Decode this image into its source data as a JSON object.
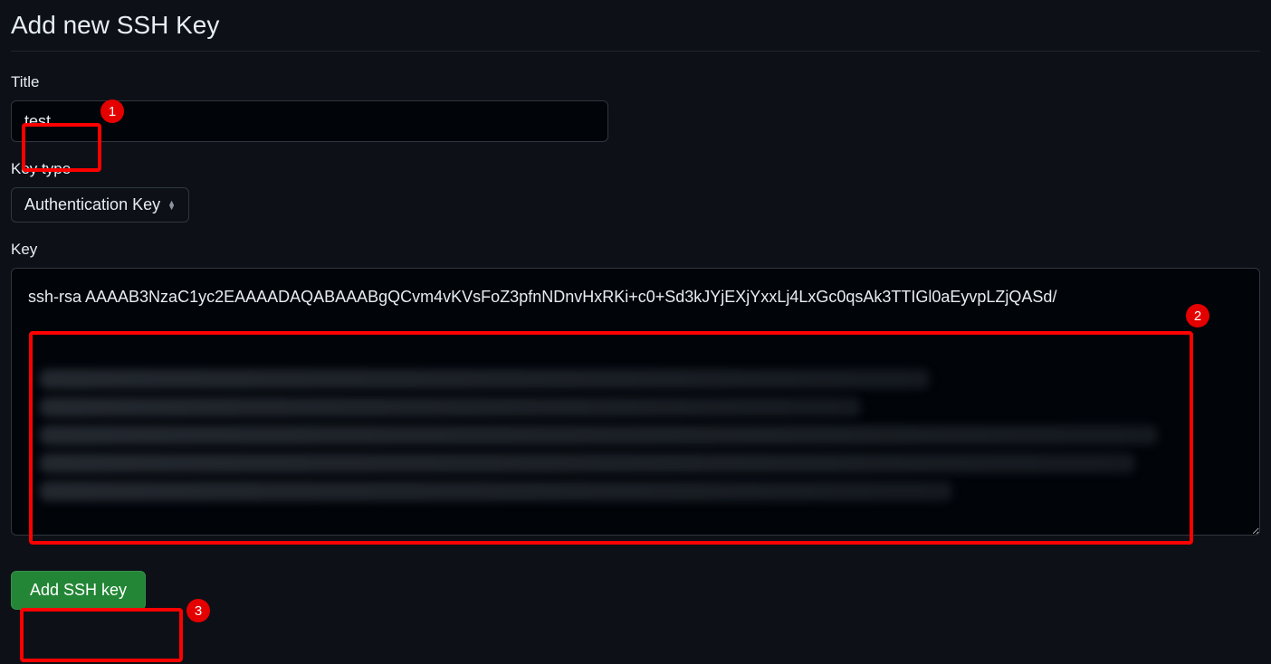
{
  "heading": "Add new SSH Key",
  "form": {
    "title": {
      "label": "Title",
      "value": "test"
    },
    "keyType": {
      "label": "Key type",
      "selected": "Authentication Key"
    },
    "key": {
      "label": "Key",
      "value": "ssh-rsa AAAAB3NzaC1yc2EAAAADAQABAAABgQCvm4vKVsFoZ3pfnNDnvHxRKi+c0+Sd3kJYjEXjYxxLj4LxGc0qsAk3TTIGl0aEyvpLZjQASd/"
    },
    "submit": {
      "label": "Add SSH key"
    }
  },
  "annotations": {
    "badge1": "1",
    "badge2": "2",
    "badge3": "3"
  }
}
